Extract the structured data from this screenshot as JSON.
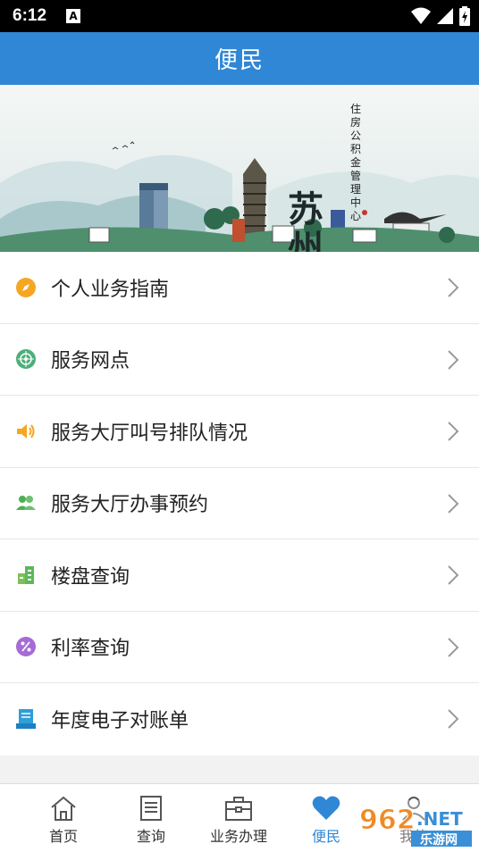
{
  "status_bar": {
    "time": "6:12",
    "notification_badge": "A"
  },
  "header": {
    "title": "便民"
  },
  "banner": {
    "calligraphy": [
      "苏",
      "州"
    ],
    "subtitle": "住房公积金管理中心"
  },
  "menu": {
    "items": [
      {
        "label": "个人业务指南",
        "icon": "compass-icon",
        "color": "#f5a623"
      },
      {
        "label": "服务网点",
        "icon": "network-icon",
        "color": "#4caf7a"
      },
      {
        "label": "服务大厅叫号排队情况",
        "icon": "speaker-icon",
        "color": "#f5a623"
      },
      {
        "label": "服务大厅办事预约",
        "icon": "people-icon",
        "color": "#4caf50"
      },
      {
        "label": "楼盘查询",
        "icon": "building-icon",
        "color": "#5cb85c"
      },
      {
        "label": "利率查询",
        "icon": "percent-icon",
        "color": "#a66bd6"
      },
      {
        "label": "年度电子对账单",
        "icon": "bill-icon",
        "color": "#2f9fd8"
      }
    ]
  },
  "tabbar": {
    "active": "便民",
    "tabs": [
      {
        "label": "首页",
        "icon": "home-icon"
      },
      {
        "label": "查询",
        "icon": "document-icon"
      },
      {
        "label": "业务办理",
        "icon": "briefcase-icon"
      },
      {
        "label": "便民",
        "icon": "heart-icon"
      },
      {
        "label": "我的",
        "icon": "person-icon"
      }
    ]
  },
  "watermark": {
    "text": "962.NET",
    "subtext": "乐游网"
  },
  "colors": {
    "primary": "#2f87d6",
    "background": "#f2f2f2"
  }
}
